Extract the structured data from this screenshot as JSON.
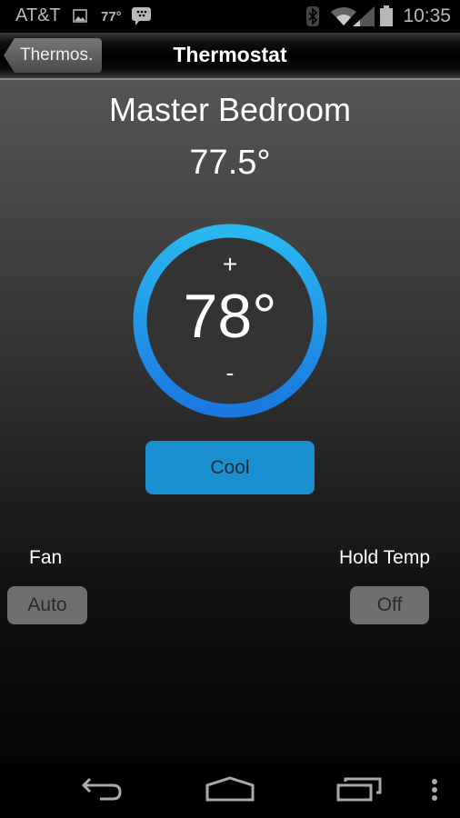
{
  "status_bar": {
    "carrier": "AT&T",
    "weather_temp": "77°",
    "time": "10:35",
    "icons": [
      "image-icon",
      "bbm-icon",
      "bluetooth-icon",
      "wifi-icon",
      "signal-icon",
      "battery-icon"
    ]
  },
  "action_bar": {
    "back_label": "Thermos.",
    "title": "Thermostat"
  },
  "thermostat": {
    "room_name": "Master Bedroom",
    "current_temp": "77.5°",
    "setpoint": "78°",
    "increase_label": "+",
    "decrease_label": "-",
    "mode_label": "Cool",
    "accent_color": "#1a8fd0"
  },
  "controls": {
    "fan_label": "Fan",
    "fan_value": "Auto",
    "hold_label": "Hold Temp",
    "hold_value": "Off"
  },
  "nav_bar": {
    "buttons": [
      "back-icon",
      "home-icon",
      "recents-icon",
      "overflow-menu-icon"
    ]
  }
}
